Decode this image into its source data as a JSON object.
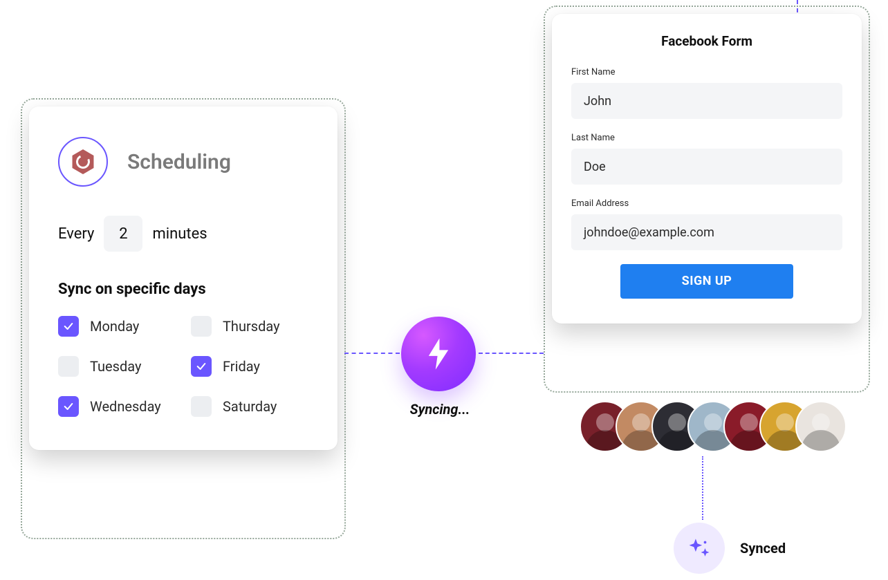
{
  "scheduling": {
    "title": "Scheduling",
    "frequency": {
      "prefix": "Every",
      "value": "2",
      "suffix": "minutes"
    },
    "sync_days_title": "Sync on specific days",
    "days": [
      {
        "label": "Monday",
        "checked": true
      },
      {
        "label": "Tuesday",
        "checked": false
      },
      {
        "label": "Wednesday",
        "checked": true
      },
      {
        "label": "Thursday",
        "checked": false
      },
      {
        "label": "Friday",
        "checked": true
      },
      {
        "label": "Saturday",
        "checked": false
      }
    ]
  },
  "syncing_label": "Syncing...",
  "form": {
    "title": "Facebook Form",
    "fields": {
      "first_name": {
        "label": "First Name",
        "value": "John"
      },
      "last_name": {
        "label": "Last Name",
        "value": "Doe"
      },
      "email": {
        "label": "Email Address",
        "value": "johndoe@example.com"
      }
    },
    "submit_label": "SIGN UP"
  },
  "avatars": [
    {
      "bg": "#78202a"
    },
    {
      "bg": "#c28a63"
    },
    {
      "bg": "#2d2d34"
    },
    {
      "bg": "#9fb7c9"
    },
    {
      "bg": "#8a1b29"
    },
    {
      "bg": "#d7a42f"
    },
    {
      "bg": "#e9e4df"
    }
  ],
  "synced_label": "Synced",
  "colors": {
    "accent": "#6a56ff",
    "primary_button": "#1f7ff0"
  }
}
